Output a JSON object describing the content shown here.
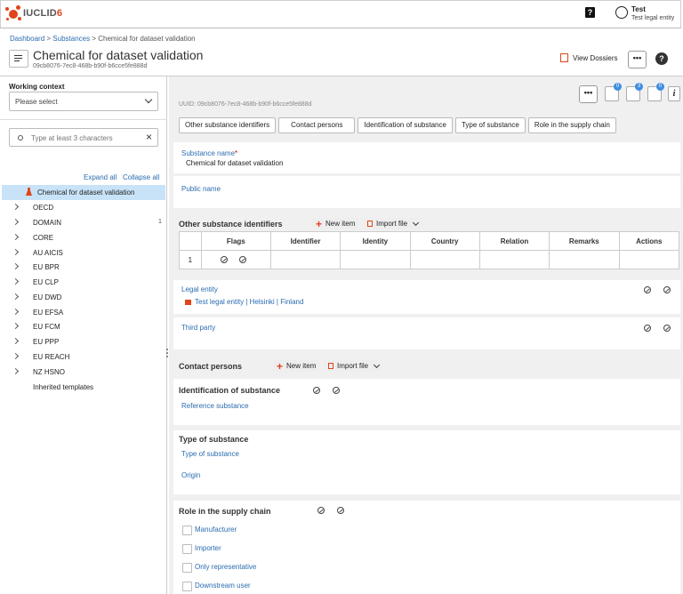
{
  "app": {
    "brand_prefix": "IUCLID",
    "brand_suffix": "6"
  },
  "topbar": {
    "help_label": "?",
    "user_name": "Test",
    "user_entity": "Test legal entity"
  },
  "breadcrumb": {
    "dashboard": "Dashboard",
    "sep": ">",
    "substances": "Substances",
    "current": "Chemical for dataset validation"
  },
  "header": {
    "title": "Chemical for dataset validation",
    "uuid": "09cb8076-7ec8-468b-b90f-b6cce5fe888d",
    "view_dossiers": "View Dossiers",
    "more": "•••",
    "help": "?"
  },
  "sidebar": {
    "working_context_label": "Working context",
    "working_context_value": "Please select",
    "search_placeholder": "Type at least 3 characters",
    "expand_all": "Expand all",
    "collapse_all": "Collapse all",
    "selected_item": "Chemical for dataset validation",
    "items": [
      {
        "label": "OECD",
        "count": ""
      },
      {
        "label": "DOMAIN",
        "count": "1"
      },
      {
        "label": "CORE",
        "count": ""
      },
      {
        "label": "AU AICIS",
        "count": ""
      },
      {
        "label": "EU BPR",
        "count": ""
      },
      {
        "label": "EU CLP",
        "count": ""
      },
      {
        "label": "EU DWD",
        "count": ""
      },
      {
        "label": "EU EFSA",
        "count": ""
      },
      {
        "label": "EU FCM",
        "count": ""
      },
      {
        "label": "EU PPP",
        "count": ""
      },
      {
        "label": "EU REACH",
        "count": ""
      },
      {
        "label": "NZ HSNO",
        "count": ""
      },
      {
        "label": "Inherited templates",
        "count": ""
      }
    ]
  },
  "main": {
    "uuid": "UUID: 09cb8076-7ec8-468b-b90f-b6cce5fe888d",
    "more": "•••",
    "badges": {
      "attachments": "0",
      "history": "3",
      "annotations": "0"
    },
    "info": "i",
    "tabs": [
      "Other substance identifiers",
      "Contact persons",
      "Identification of substance",
      "Type of substance",
      "Role in the supply chain"
    ],
    "substance_name_label": "Substance name",
    "substance_name_required": "*",
    "substance_name_value": "Chemical for dataset validation",
    "public_name_label": "Public name",
    "other_ids_title": "Other substance identifiers",
    "new_item": "New item",
    "import_file": "Import file",
    "table": {
      "headers": [
        "",
        "Flags",
        "Identifier",
        "Identity",
        "Country",
        "Relation",
        "Remarks",
        "Actions"
      ],
      "rows": [
        {
          "index": "1"
        }
      ]
    },
    "legal_entity_label": "Legal entity",
    "legal_entity_value": "Test legal entity | Helsinki | Finland",
    "third_party_label": "Third party",
    "contact_persons_title": "Contact persons",
    "identification_title": "Identification of substance",
    "reference_substance_label": "Reference substance",
    "type_of_substance_title": "Type of substance",
    "type_of_substance_label": "Type of substance",
    "origin_label": "Origin",
    "role_title": "Role in the supply chain",
    "roles": [
      "Manufacturer",
      "Importer",
      "Only representative",
      "Downstream user"
    ]
  },
  "colors": {
    "accent": "#e0441a",
    "link": "#2b6cb0",
    "selected": "#c8e3f8",
    "badge": "#3d8ee0"
  }
}
